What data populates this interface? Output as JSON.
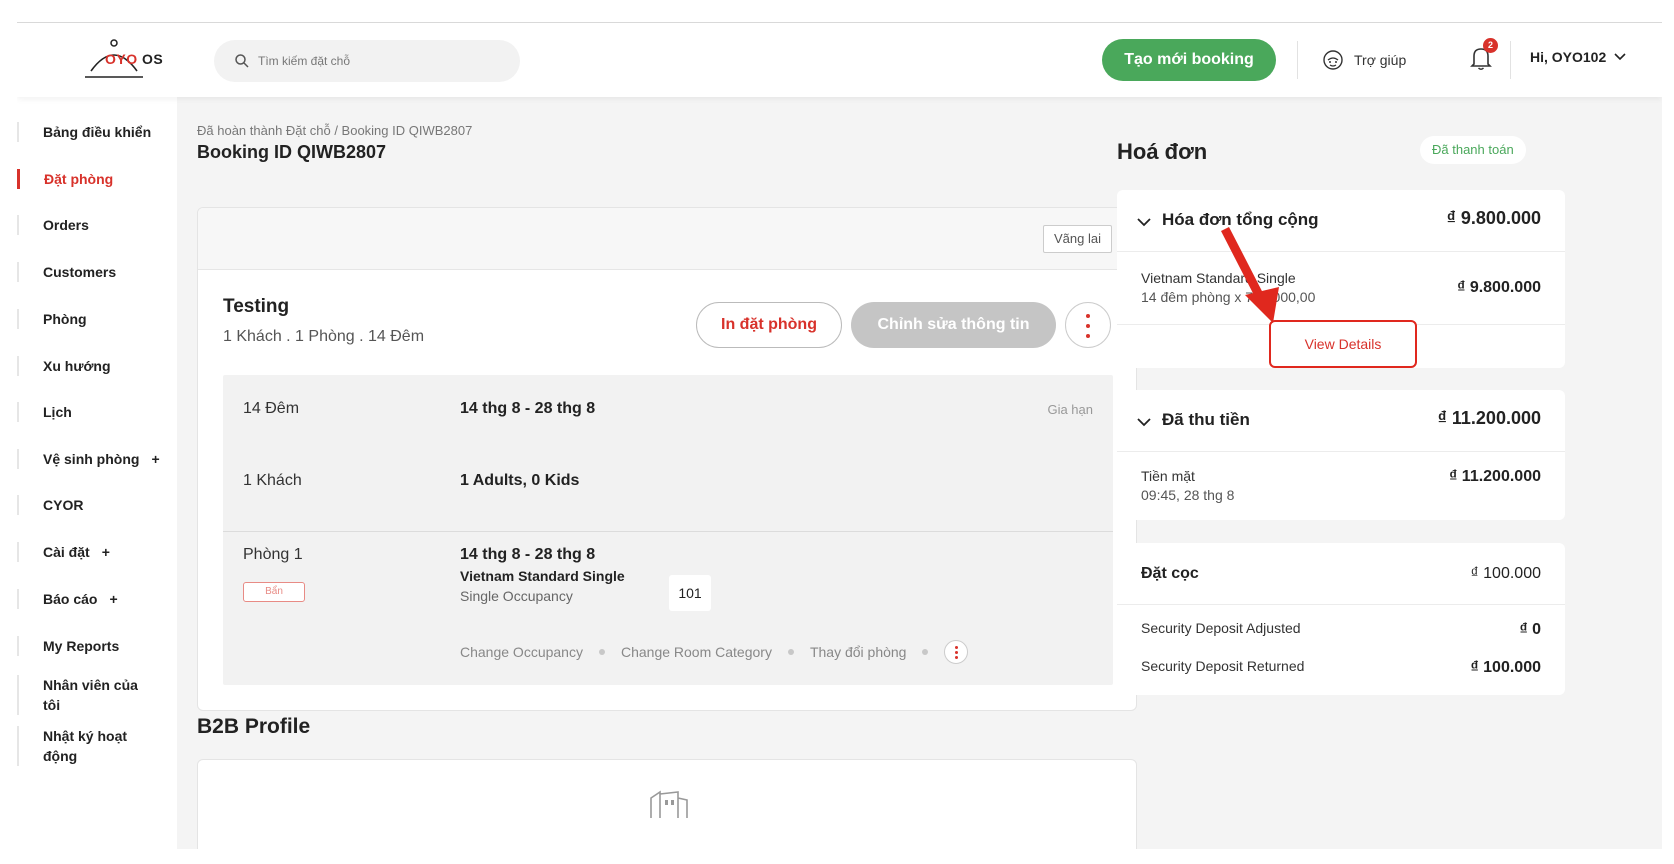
{
  "header": {
    "logo_text": "OYO OS",
    "logo_brand": "OYO",
    "logo_suffix": "OS",
    "search_placeholder": "Tìm kiếm đặt chỗ",
    "new_booking_label": "Tạo mới booking",
    "help_label": "Trợ giúp",
    "notification_count": "2",
    "user_label": "Hi, OYO102"
  },
  "sidebar": {
    "items": [
      {
        "label": "Bảng điều khiển",
        "active": false
      },
      {
        "label": "Đặt phòng",
        "active": true
      },
      {
        "label": "Orders",
        "active": false
      },
      {
        "label": "Customers",
        "active": false
      },
      {
        "label": "Phòng",
        "active": false
      },
      {
        "label": "Xu hướng",
        "active": false
      },
      {
        "label": "Lịch",
        "active": false
      },
      {
        "label": "Vệ sinh phòng",
        "active": false,
        "expandable": true
      },
      {
        "label": "CYOR",
        "active": false
      },
      {
        "label": "Cài đặt",
        "active": false,
        "expandable": true
      },
      {
        "label": "Báo cáo",
        "active": false,
        "expandable": true
      },
      {
        "label": "My Reports",
        "active": false
      },
      {
        "label": "Nhân viên của tôi",
        "active": false
      },
      {
        "label": "Nhật ký hoạt động",
        "active": false
      }
    ],
    "plus_symbol": "+"
  },
  "main": {
    "breadcrumb": "Đã hoàn thành Đặt chỗ / Booking ID QIWB2807",
    "title": "Booking ID QIWB2807",
    "walkin_tag": "Vãng lai",
    "guest_name": "Testing",
    "guest_summary": "1 Khách . 1 Phòng . 14 Đêm",
    "print_button": "In đặt phòng",
    "edit_button": "Chỉnh sửa thông tin",
    "details": {
      "nights_label": "14 Đêm",
      "nights_value": "14 thg 8 - 28 thg 8",
      "extend_label": "Gia hạn",
      "guests_label": "1 Khách",
      "guests_value": "1 Adults, 0 Kids",
      "room_label": "Phòng 1",
      "room_status": "Bẩn",
      "room_dates": "14 thg 8 - 28 thg 8",
      "room_category": "Vietnam Standard Single",
      "room_occupancy": "Single Occupancy",
      "room_number": "101",
      "actions": [
        "Change Occupancy",
        "Change Room Category",
        "Thay đổi phòng"
      ]
    },
    "b2b_title": "B2B Profile"
  },
  "invoice": {
    "title": "Hoá đơn",
    "status": "Đã thanh toán",
    "total": {
      "label": "Hóa đơn tổng cộng",
      "amount": "₫ 9.800.000",
      "line_title": "Vietnam Standard Single",
      "line_sub": "14 đêm phòng x 700.000,00",
      "line_amount": "₫ 9.800.000",
      "view_details": "View Details"
    },
    "collected": {
      "label": "Đã thu tiền",
      "amount": "₫ 11.200.000",
      "line_title": "Tiền mặt",
      "line_sub": "09:45, 28 thg 8",
      "line_amount": "₫ 11.200.000"
    },
    "deposit": {
      "label": "Đặt cọc",
      "amount": "₫ 100.000",
      "adjusted_label": "Security Deposit Adjusted",
      "adjusted_amount": "₫ 0",
      "returned_label": "Security Deposit Returned",
      "returned_amount": "₫ 100.000"
    }
  },
  "colors": {
    "brand_red": "#d8322b",
    "primary_green": "#4aa85b",
    "annotation_red": "#e0281e"
  },
  "icons": [
    "logo-bell-icon",
    "search-icon",
    "support-icon",
    "bell-icon",
    "chevron-down-icon",
    "more-vertical-icon",
    "building-icon",
    "annotation-arrow"
  ]
}
